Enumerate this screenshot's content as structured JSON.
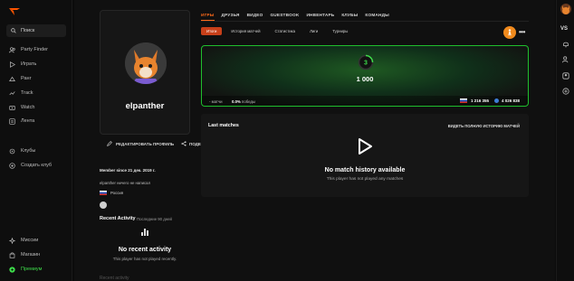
{
  "sidebar": {
    "search_label": "Поиск",
    "items": [
      {
        "label": "Party Finder",
        "icon": "users-icon"
      },
      {
        "label": "Играть",
        "icon": "play-icon"
      },
      {
        "label": "Ранг",
        "icon": "rank-icon"
      },
      {
        "label": "Track",
        "icon": "track-icon"
      },
      {
        "label": "Watch",
        "icon": "watch-icon"
      },
      {
        "label": "Лента",
        "icon": "feed-icon"
      }
    ],
    "clubs": [
      {
        "label": "Клубы",
        "icon": "clubs-icon"
      },
      {
        "label": "Создать клуб",
        "icon": "plus-circle-icon"
      }
    ],
    "bottom": [
      {
        "label": "Миссии",
        "icon": "missions-icon"
      },
      {
        "label": "Магазин",
        "icon": "shop-icon"
      },
      {
        "label": "Премиум",
        "icon": "premium-icon"
      }
    ]
  },
  "rail": {
    "vs_label": "VS"
  },
  "profile": {
    "name": "elpanther",
    "edit_label": "РЕДАКТИРОВАТЬ ПРОФИЛЬ",
    "share_label": "ПОДЕ",
    "member_since": "Member since 21 дек. 2019 г.",
    "about": "elpanther ничего не написал",
    "country": "Россия"
  },
  "recent": {
    "title": "Recent Activity",
    "subtitle": "Последние 90 дней",
    "empty_title": "No recent activity",
    "empty_desc": "This player has not played recently.",
    "faded": "Recent activity"
  },
  "tabs": [
    "ИГРЫ",
    "ДРУЗЬЯ",
    "ВИДЕО",
    "GUESTBOOK",
    "ИНВЕНТАРЬ",
    "КЛУБЫ",
    "КОМАНДЫ"
  ],
  "subtabs": [
    "Итоги",
    "История матчей",
    "Статистика",
    "Лиги",
    "Турниры"
  ],
  "stats": {
    "level": "3",
    "elo": "1 000",
    "matches_label": "матчи",
    "matches_value": "-",
    "winrate_value": "0.0%",
    "winrate_label": "победы",
    "country_rank": "1 216 355",
    "global_rank": "4 026 838",
    "accent": "#1fbf2d"
  },
  "last_matches": {
    "title": "Last matches",
    "link": "ВИДЕТЬ ПОЛНУЮ ИСТОРИЮ МАТЧЕЙ",
    "empty_title": "No match history available",
    "empty_desc": "This player has not played any matches"
  },
  "colors": {
    "brand": "#ff6a1a",
    "premium": "#3ddc4a"
  }
}
